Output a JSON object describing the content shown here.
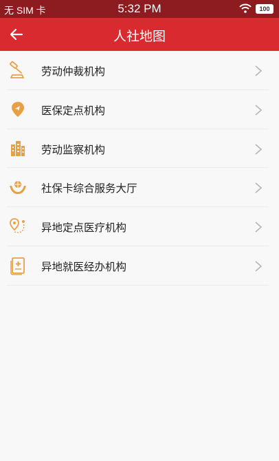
{
  "status_bar": {
    "carrier": "无 SIM 卡",
    "time": "5:32 PM",
    "battery": "100"
  },
  "nav": {
    "back_icon": "arrow-left-icon",
    "title": "人社地图"
  },
  "colors": {
    "status_bar": "#8c1c1f",
    "nav_bar": "#d92b2f",
    "icon_orange": "#e8a047",
    "background": "#f8f8f8"
  },
  "items": [
    {
      "label": "劳动仲裁机构",
      "icon": "gavel-icon"
    },
    {
      "label": "医保定点机构",
      "icon": "location-pin-icon"
    },
    {
      "label": "劳动监察机构",
      "icon": "building-icon"
    },
    {
      "label": "社保卡综合服务大厅",
      "icon": "hands-globe-icon"
    },
    {
      "label": "异地定点医疗机构",
      "icon": "route-pin-icon"
    },
    {
      "label": "异地就医经办机构",
      "icon": "medical-card-icon"
    }
  ]
}
